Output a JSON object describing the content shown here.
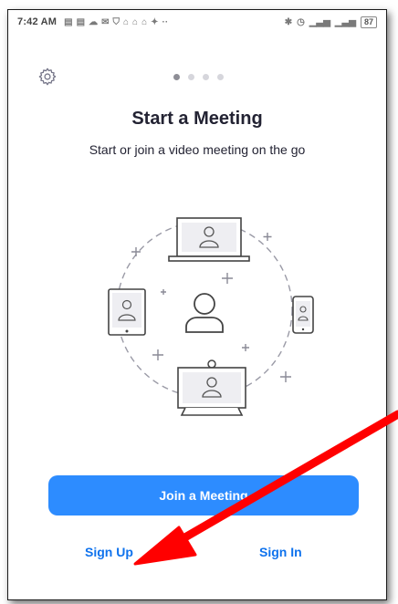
{
  "status_bar": {
    "time": "7:42 AM",
    "battery": "87"
  },
  "onboarding": {
    "title": "Start a Meeting",
    "subtitle": "Start or join a video meeting on the go",
    "active_page": 1,
    "page_count": 4
  },
  "actions": {
    "join_label": "Join a Meeting",
    "signup_label": "Sign Up",
    "signin_label": "Sign In"
  },
  "colors": {
    "accent": "#2d8cff",
    "link": "#0e72ed",
    "arrow": "#ff0000"
  },
  "icons": [
    "gear-icon",
    "user-icon",
    "laptop-icon",
    "tablet-icon",
    "phone-icon",
    "room-system-icon"
  ]
}
